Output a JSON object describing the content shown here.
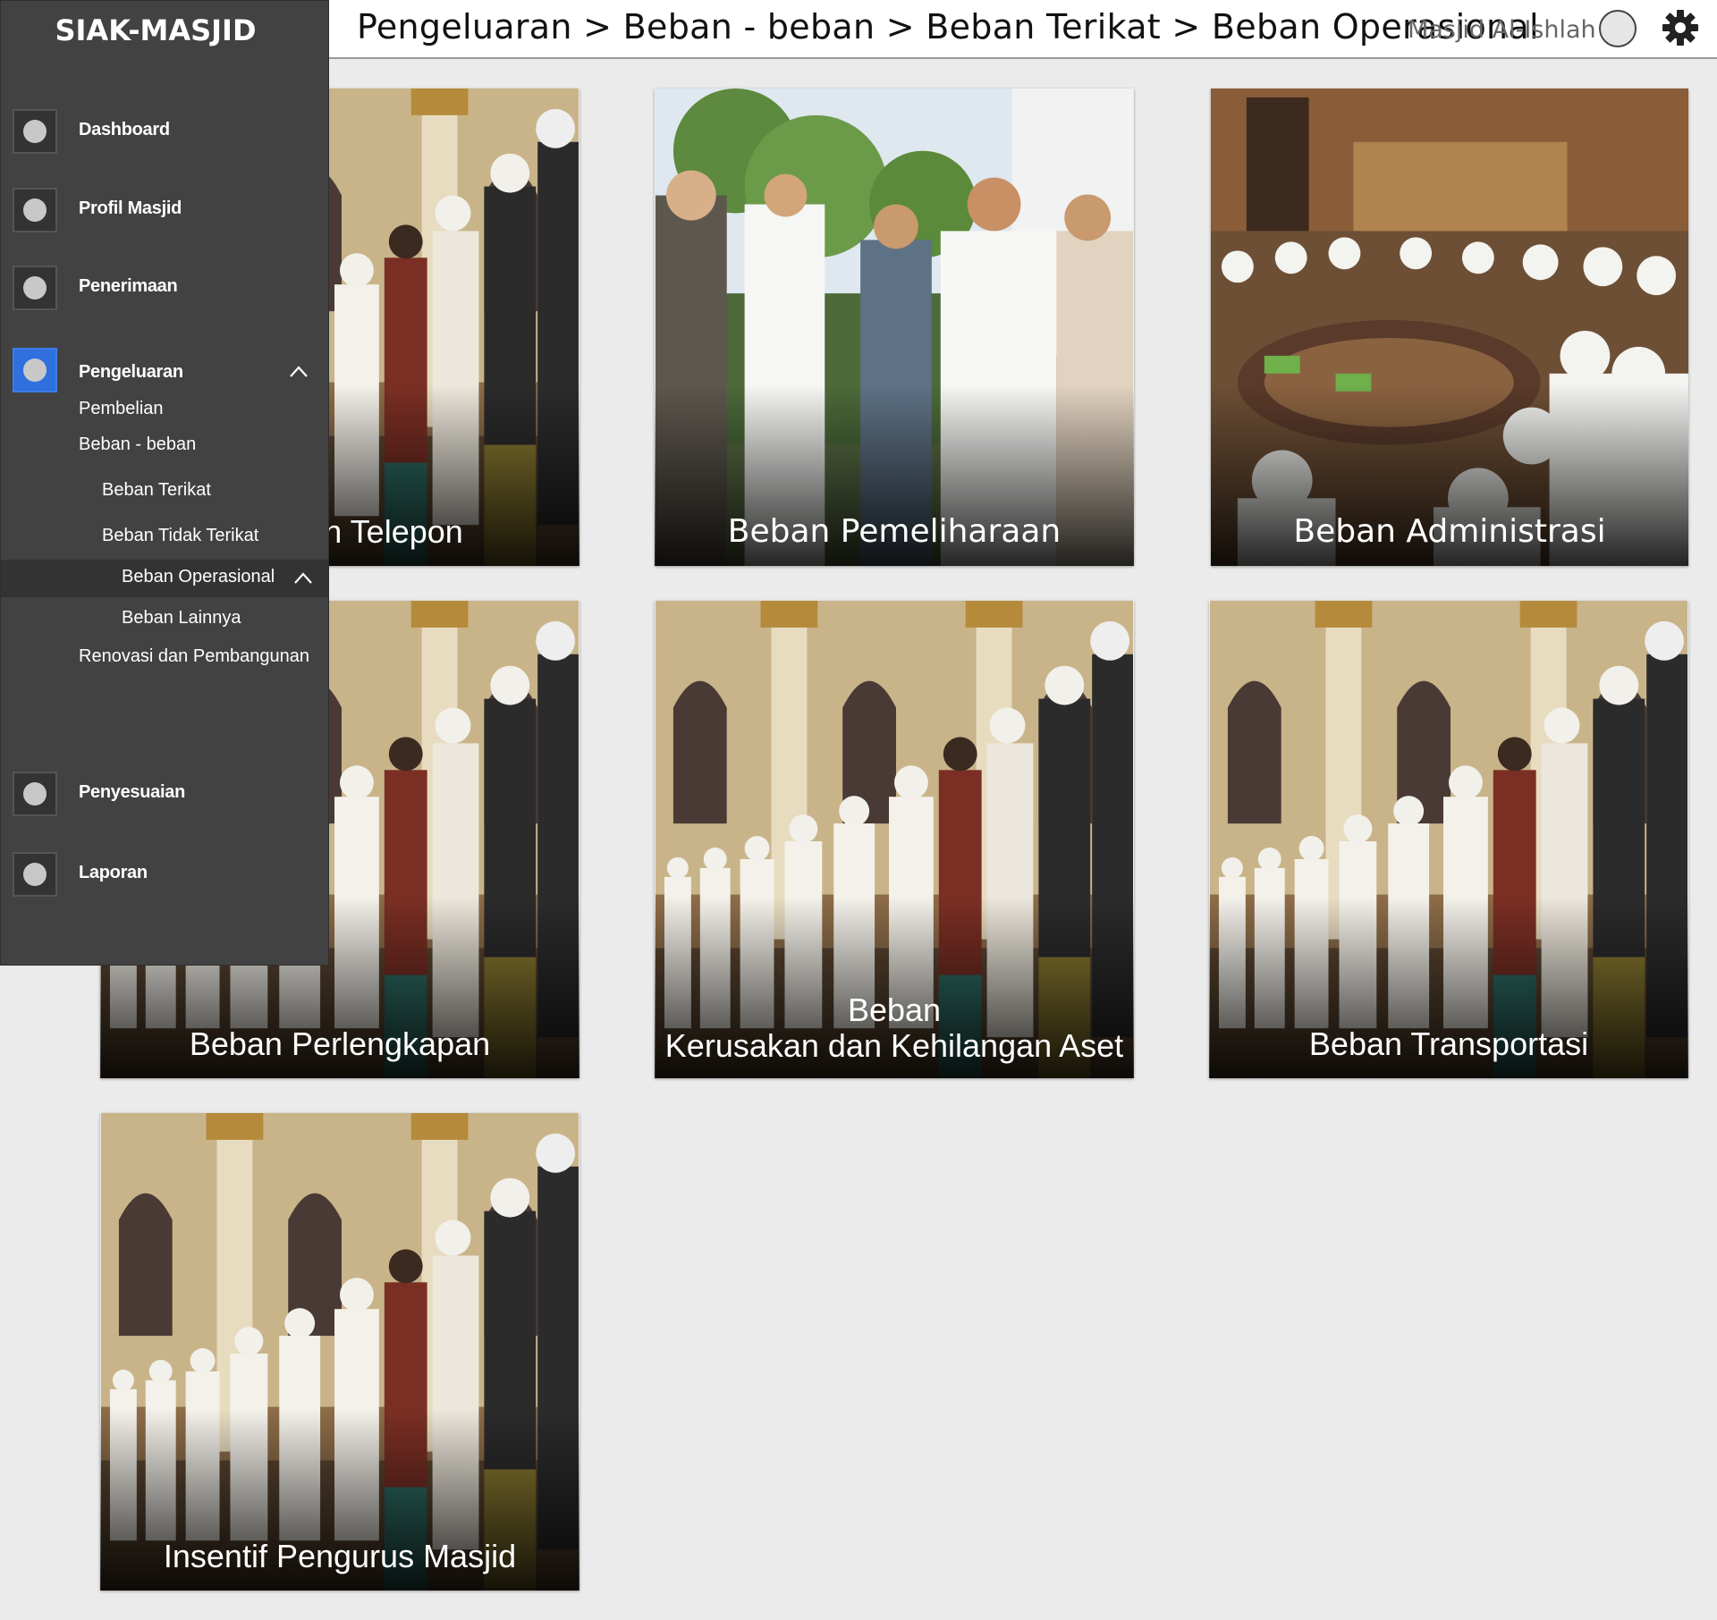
{
  "app": {
    "title": "SIAK-MASJID"
  },
  "header": {
    "breadcrumb": "Pengeluaran > Beban - beban > Beban Terikat > Beban Operasional",
    "masjid_name": "Masjid Al-Ishlah"
  },
  "sidebar": {
    "items": [
      {
        "label": "Dashboard"
      },
      {
        "label": "Profil Masjid"
      },
      {
        "label": "Penerimaan"
      },
      {
        "label": "Pengeluaran"
      },
      {
        "label": "Penyesuaian"
      },
      {
        "label": "Laporan"
      }
    ],
    "sub": {
      "pembelian": "Pembelian",
      "beban": "Beban - beban",
      "beban_terikat": "Beban Terikat",
      "beban_tidak_terikat": "Beban Tidak Terikat",
      "beban_operasional": "Beban Operasional",
      "beban_lainnya": "Beban Lainnya",
      "renovasi": "Renovasi dan Pembangunan"
    }
  },
  "tiles": [
    {
      "caption": ", Air, dan Telepon",
      "image": "mosque-prayer-photo"
    },
    {
      "caption": "Beban Pemeliharaan",
      "image": "people-greeting-photo"
    },
    {
      "caption": "Beban Administrasi",
      "image": "gathering-photo"
    },
    {
      "caption": "Beban Perlengkapan",
      "image": "mosque-prayer-photo"
    },
    {
      "caption_line1": "Beban",
      "caption_line2": "Kerusakan dan Kehilangan Aset",
      "image": "mosque-prayer-photo"
    },
    {
      "caption": "Beban Transportasi",
      "image": "mosque-prayer-photo"
    },
    {
      "caption": "Insentif Pengurus Masjid",
      "image": "mosque-prayer-photo"
    }
  ],
  "colors": {
    "sidebar_bg": "#424242",
    "active_icon": "#2f6fde",
    "page_bg": "#ebebeb"
  }
}
